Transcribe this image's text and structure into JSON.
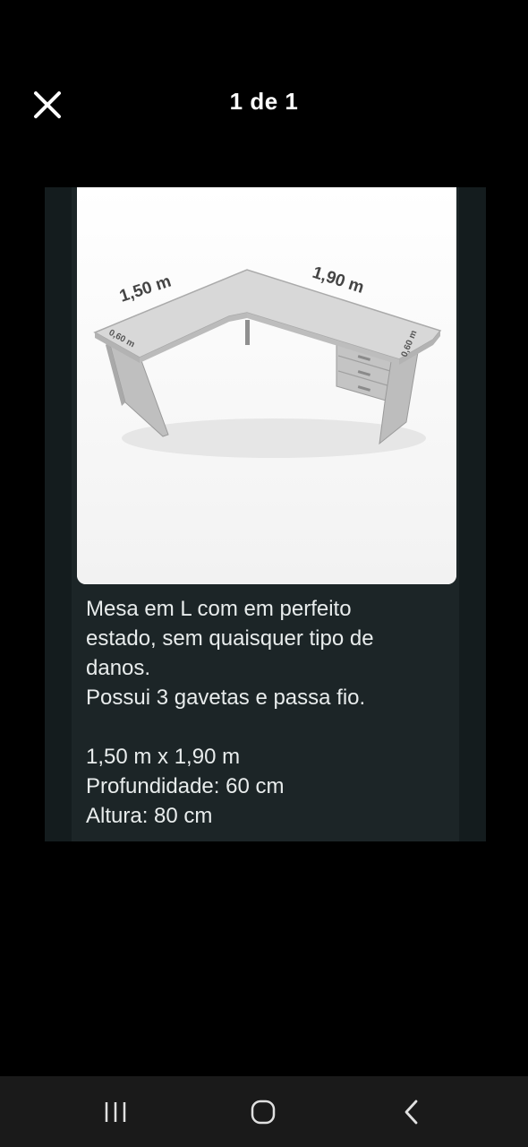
{
  "header": {
    "counter": "1 de 1"
  },
  "photo": {
    "dim_width_left": "1,50 m",
    "dim_width_right": "1,90 m",
    "dim_depth_left": "0,60 m",
    "dim_depth_right": "0,60 m"
  },
  "caption": {
    "line1": "Mesa em L com em perfeito",
    "line2": "estado, sem quaisquer tipo de",
    "line3": "danos.",
    "line4": "Possui 3 gavetas e passa fio.",
    "line5": "1,50 m x 1,90 m",
    "line6": "Profundidade: 60 cm",
    "line7": "Altura: 80 cm"
  },
  "icons": {
    "close": "close-icon",
    "recent_apps": "recent-apps-icon",
    "home": "home-icon",
    "back": "back-icon"
  },
  "colors": {
    "background": "#000000",
    "viewer_bg": "#1c2527",
    "text": "#ffffff",
    "navbar": "#1a1a1a"
  }
}
